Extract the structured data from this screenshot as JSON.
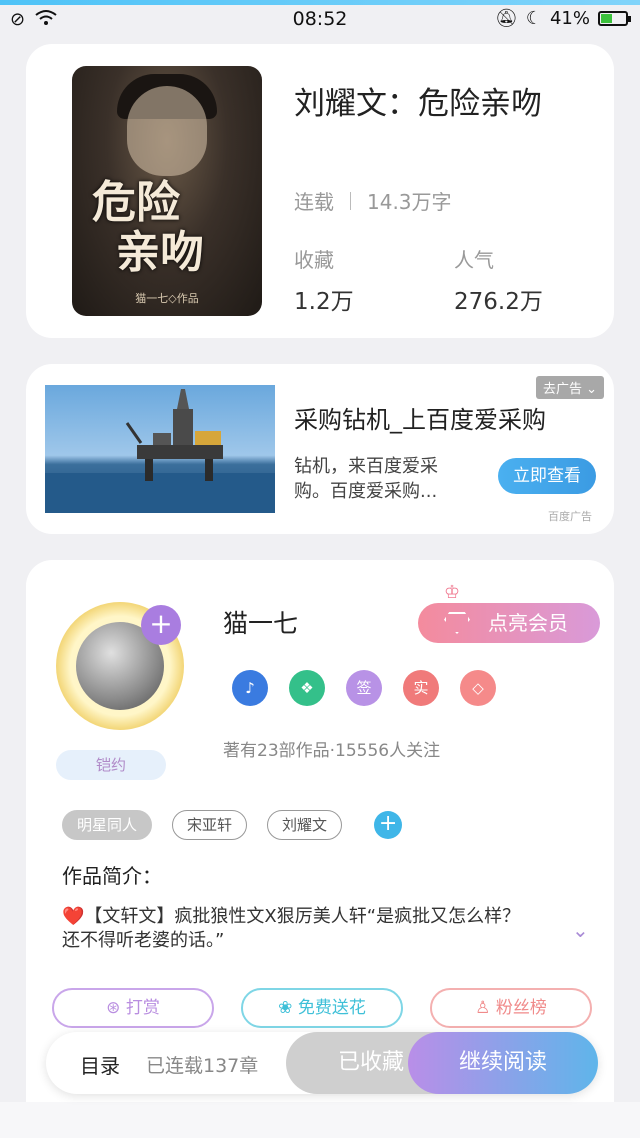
{
  "status_bar": {
    "time": "08:52",
    "battery": "41%",
    "battery_level": 0.41
  },
  "book": {
    "title": "刘耀文：危险亲吻",
    "status": "连载",
    "word_count": "14.3万字",
    "favorites_label": "收藏",
    "favorites_value": "1.2万",
    "popularity_label": "人气",
    "popularity_value": "276.2万",
    "cover": {
      "title_line1": "危险",
      "title_line2": "亲吻",
      "author": "猫一七◇作品"
    }
  },
  "ad": {
    "badge": "去广告",
    "title": "采购钻机_上百度爱采购",
    "description": "钻机，来百度爱采购。百度爱采购...",
    "button": "立即查看",
    "source": "百度广告"
  },
  "author": {
    "name": "猫一七",
    "vip_button": "点亮会员",
    "tag": "铠约",
    "meta": "著有23部作品·15556人关注",
    "medals": [
      {
        "icon": "music-note-icon",
        "glyph": "♪",
        "color": "#3a7be0"
      },
      {
        "icon": "handshake-icon",
        "glyph": "❖",
        "color": "#34c08a"
      },
      {
        "icon": "sign-icon",
        "glyph": "签",
        "color": "#b892e6"
      },
      {
        "icon": "real-icon",
        "glyph": "实",
        "color": "#f07a7a"
      },
      {
        "icon": "diamond-icon",
        "glyph": "◇",
        "color": "#f58a8a"
      }
    ]
  },
  "tags": {
    "primary": "明星同人",
    "t1": "宋亚轩",
    "t2": "刘耀文"
  },
  "intro": {
    "label": "作品简介：",
    "text": "❤️【文轩文】疯批狼性文X狠厉美人轩“是疯批又怎么样？还不得听老婆的话。”"
  },
  "actions": [
    {
      "label": "打赏",
      "icon": "coin-icon",
      "color": "#b98ee0"
    },
    {
      "label": "免费送花",
      "icon": "flower-icon",
      "color": "#3fc0d8"
    },
    {
      "label": "粉丝榜",
      "icon": "user-icon",
      "color": "#f08a8a"
    }
  ],
  "bottom_bar": {
    "toc": "目录",
    "chapters": "已连载137章",
    "favorited": "已收藏",
    "continue": "继续阅读"
  }
}
